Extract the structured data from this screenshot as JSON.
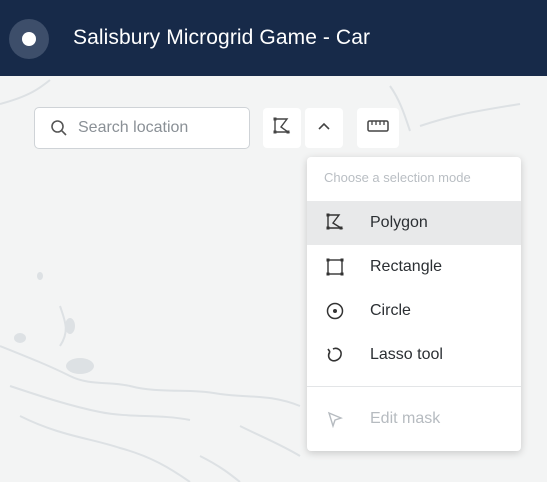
{
  "header": {
    "title": "Salisbury Microgrid Game - Car",
    "bg_color": "#172a49"
  },
  "search": {
    "placeholder": "Search location",
    "icon": "search-icon"
  },
  "toolbar": {
    "polygon_icon": "polygon-select-icon",
    "chevron_icon": "chevron-up-icon",
    "ruler_icon": "ruler-icon"
  },
  "selection_menu": {
    "heading": "Choose a selection mode",
    "items": [
      {
        "label": "Polygon",
        "icon": "polygon-icon",
        "selected": true
      },
      {
        "label": "Rectangle",
        "icon": "rectangle-icon"
      },
      {
        "label": "Circle",
        "icon": "circle-icon"
      },
      {
        "label": "Lasso tool",
        "icon": "lasso-icon"
      }
    ],
    "edit": {
      "label": "Edit mask",
      "icon": "cursor-icon",
      "disabled": true
    }
  }
}
